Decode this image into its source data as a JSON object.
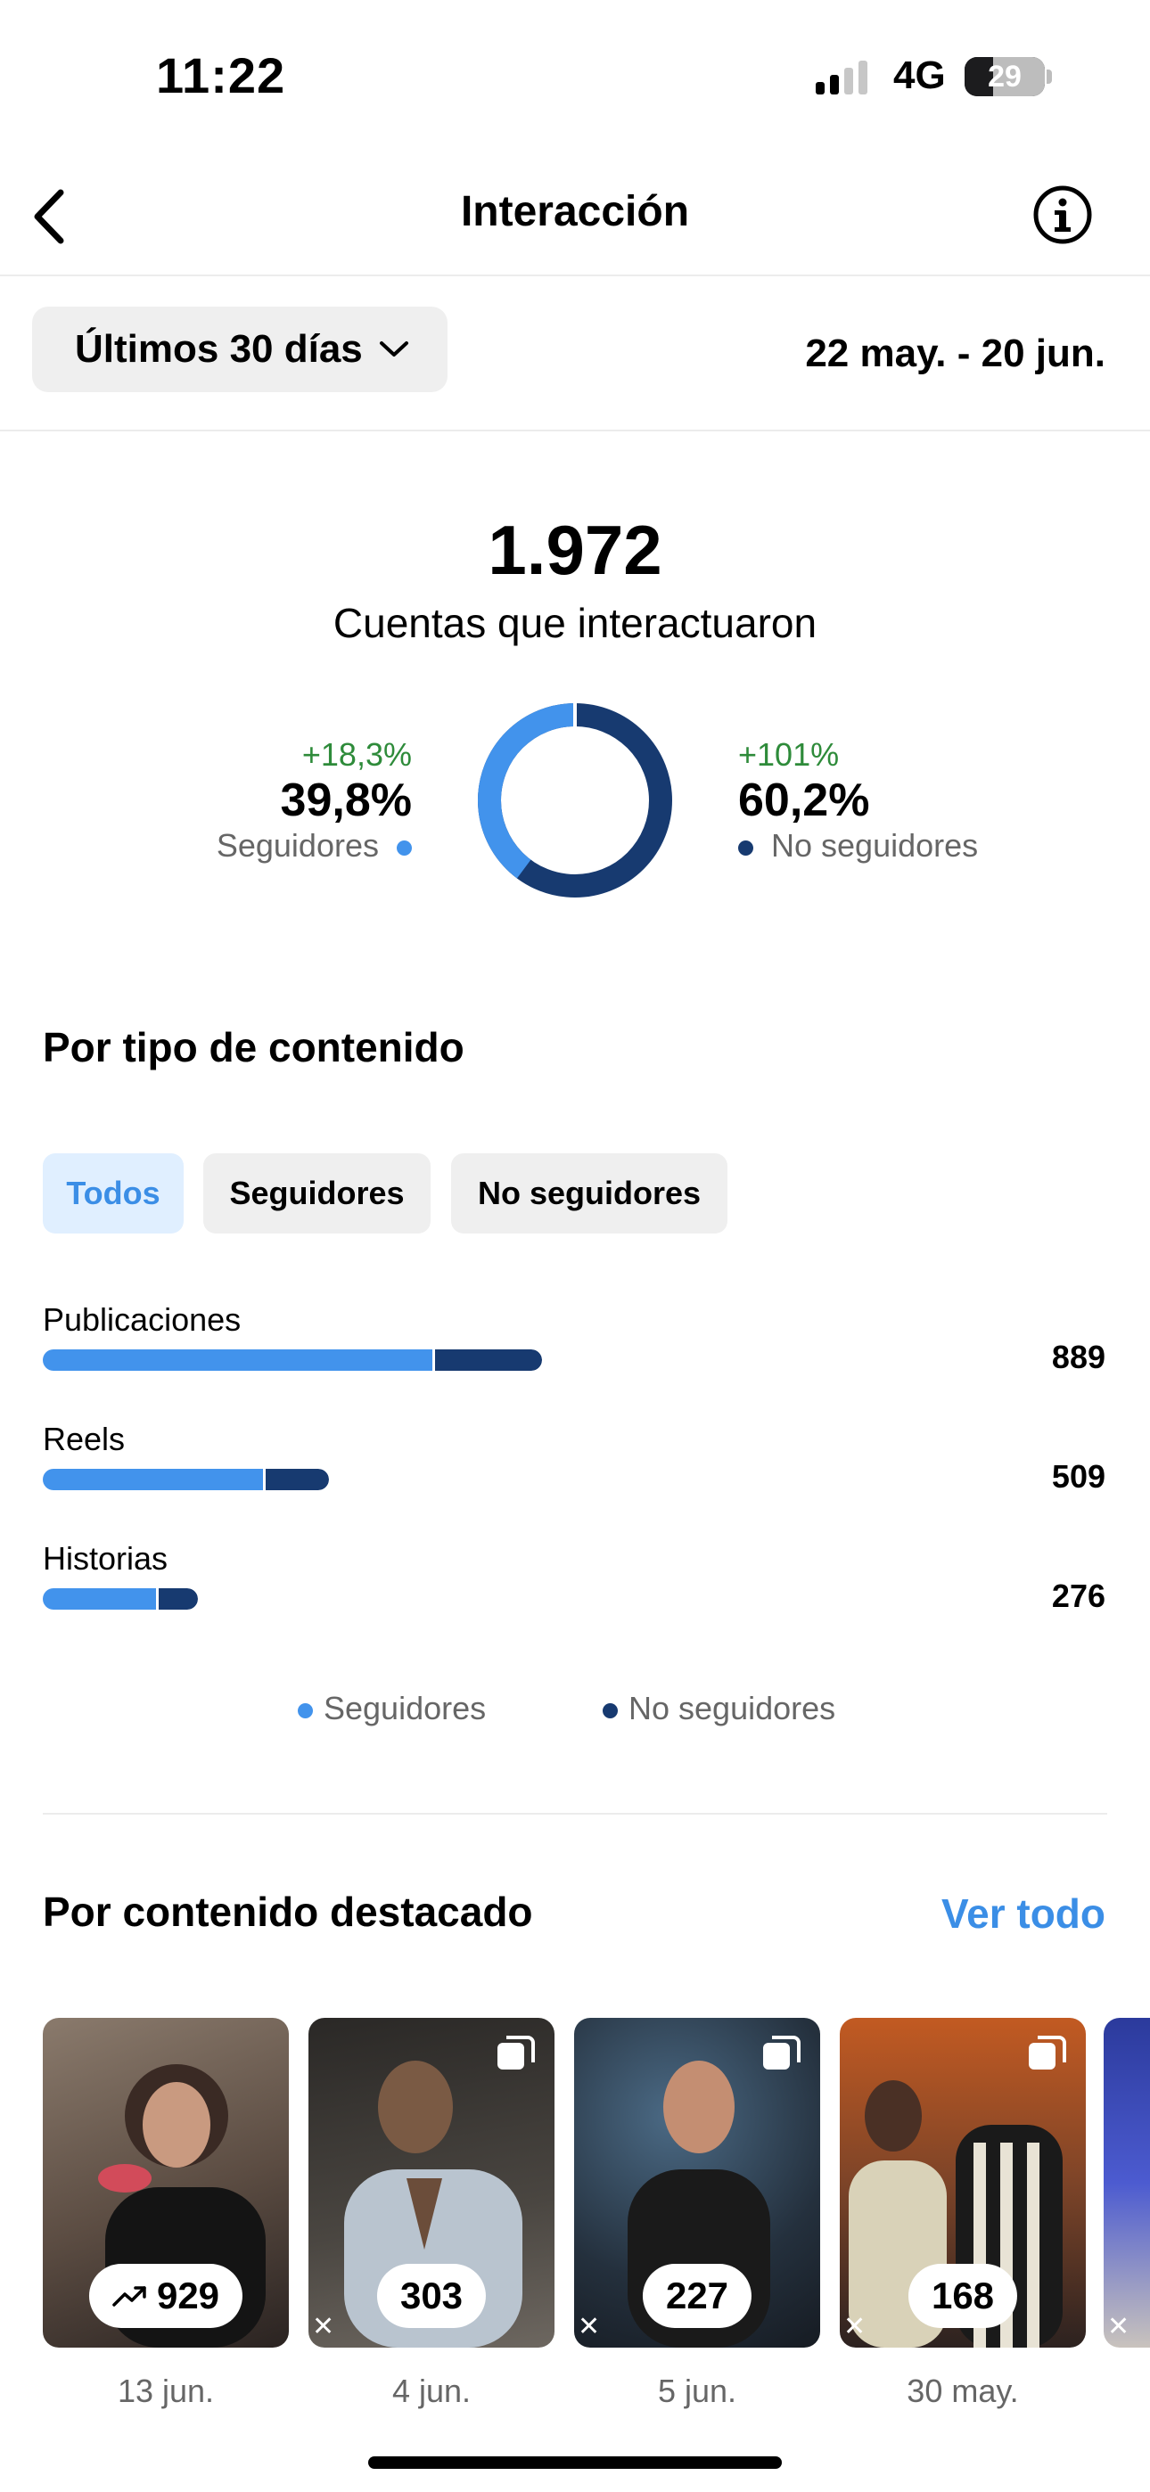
{
  "status_bar": {
    "time": "11:22",
    "network": "4G",
    "battery": "29"
  },
  "nav": {
    "title": "Interacción",
    "back_icon": "chevron-left-icon",
    "info_icon": "info-icon"
  },
  "filter": {
    "period_label": "Últimos 30 días",
    "date_range": "22 may. - 20 jun."
  },
  "summary": {
    "total": "1.972",
    "label": "Cuentas que interactuaron",
    "followers": {
      "delta": "+18,3%",
      "pct": "39,8%",
      "label": "Seguidores",
      "share": 0.398
    },
    "non_followers": {
      "delta": "+101%",
      "pct": "60,2%",
      "label": "No seguidores",
      "share": 0.602
    },
    "colors": {
      "followers": "#4293ec",
      "non_followers": "#173a70",
      "delta": "#2e8b3a"
    }
  },
  "content_type": {
    "title": "Por tipo de contenido",
    "chips": [
      {
        "label": "Todos",
        "active": true
      },
      {
        "label": "Seguidores",
        "active": false
      },
      {
        "label": "No seguidores",
        "active": false
      }
    ],
    "rows": [
      {
        "label": "Publicaciones",
        "value": "889",
        "total": 889,
        "followers_fraction": 0.78
      },
      {
        "label": "Reels",
        "value": "509",
        "total": 509,
        "followers_fraction": 0.77
      },
      {
        "label": "Historias",
        "value": "276",
        "total": 276,
        "followers_fraction": 0.73
      }
    ],
    "legend": {
      "followers": "Seguidores",
      "non_followers": "No seguidores"
    }
  },
  "featured": {
    "title": "Por contenido destacado",
    "see_all": "Ver todo",
    "items": [
      {
        "count": "929",
        "date": "13 jun.",
        "trending": true,
        "bg": "#6b5a4f"
      },
      {
        "count": "303",
        "date": "4 jun.",
        "trending": false,
        "bg": "#3d3a36"
      },
      {
        "count": "227",
        "date": "5 jun.",
        "trending": false,
        "bg": "#2d3b4a"
      },
      {
        "count": "168",
        "date": "30 may.",
        "trending": false,
        "bg": "#7a4a2c"
      }
    ]
  }
}
